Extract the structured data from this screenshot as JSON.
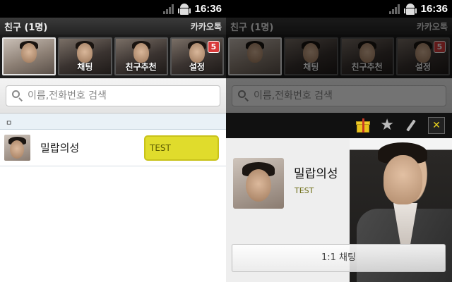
{
  "status_bar": {
    "time": "16:36"
  },
  "header": {
    "title": "친구 (1명)",
    "brand": "카카오톡"
  },
  "tabs": [
    {
      "label": "",
      "badge": ""
    },
    {
      "label": "채팅",
      "badge": ""
    },
    {
      "label": "친구추천",
      "badge": ""
    },
    {
      "label": "설정",
      "badge": "5"
    }
  ],
  "search": {
    "placeholder": "이름,전화번호 검색"
  },
  "section": {
    "label": "ㅁ"
  },
  "friends": [
    {
      "name": "밀랍의성",
      "status": "TEST"
    }
  ],
  "profile_popup": {
    "name": "밀랍의성",
    "status": "TEST",
    "chat_button": "1:1 채팅",
    "icons": [
      "gift-icon",
      "star-icon",
      "pencil-icon",
      "close-icon"
    ]
  },
  "colors": {
    "status_bubble": "#e0dc2c",
    "badge": "#d93a3a",
    "close_x": "#e8d21e"
  }
}
